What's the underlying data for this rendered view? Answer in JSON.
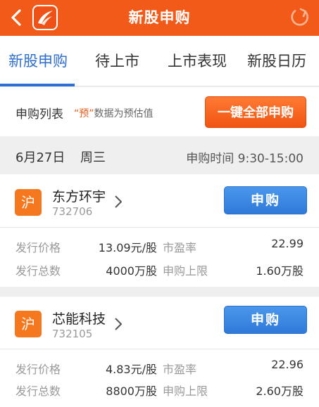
{
  "header": {
    "title": "新股申购",
    "accent": "#f25a1a",
    "icons": {
      "back": "chevron-left-icon",
      "logo": "app-logo",
      "refresh": "refresh-icon"
    }
  },
  "tabs": [
    {
      "label": "新股申购",
      "active": true
    },
    {
      "label": "待上市",
      "active": false
    },
    {
      "label": "上市表现",
      "active": false
    },
    {
      "label": "新股日历",
      "active": false
    }
  ],
  "list": {
    "title": "申购列表",
    "note_quote": "“预”",
    "note_rest": "数据为预估值",
    "one_key_button": "一键全部申购"
  },
  "date_bar": {
    "date": "6月27日",
    "weekday": "周三",
    "subscribe_time": "申购时间 9:30-15:00"
  },
  "stocks": [
    {
      "market": "沪",
      "name": "东方环宇",
      "code": "732706",
      "buy_label": "申购",
      "issue_price_label": "发行价格",
      "issue_price": "13.09元/股",
      "pe_label": "市盈率",
      "pe": "22.99",
      "total_label": "发行总数",
      "total": "4000万股",
      "limit_label": "申购上限",
      "limit": "1.60万股"
    },
    {
      "market": "沪",
      "name": "芯能科技",
      "code": "732105",
      "buy_label": "申购",
      "issue_price_label": "发行价格",
      "issue_price": "4.83元/股",
      "pe_label": "市盈率",
      "pe": "22.96",
      "total_label": "发行总数",
      "total": "8800万股",
      "limit_label": "申购上限",
      "limit": "2.60万股"
    }
  ]
}
